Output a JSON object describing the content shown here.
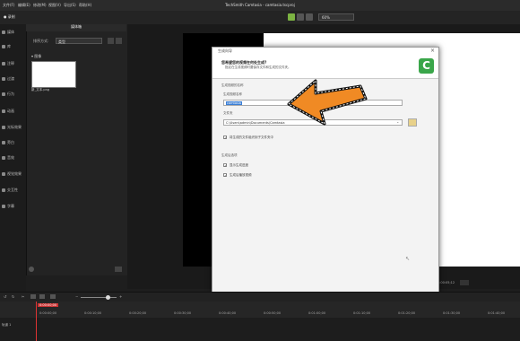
{
  "app": {
    "title": "TechSmith Camtasia - camtasia.tscproj",
    "menus": [
      "文件(F)",
      "编辑(E)",
      "修改(M)",
      "视图(V)",
      "导出(S)",
      "帮助(H)"
    ],
    "zoom": "60%"
  },
  "sidebar": {
    "items": [
      "媒体",
      "库",
      "注释",
      "过渡",
      "行为",
      "动画",
      "光标效果",
      "旁白",
      "音效",
      "视觉效果",
      "交互性",
      "字幕"
    ]
  },
  "media_bin": {
    "title": "媒体箱",
    "sort_label": "排序方式:",
    "sort_value": "类型",
    "section": "图像",
    "file_name": "新_文本.png"
  },
  "dialog": {
    "title": "生成向导",
    "heading": "您希望您的视频在何处生成?",
    "subheading": "指定在生成视频时要保存文件和生成的文件夹。",
    "section_file": "生成视频的名称",
    "label_name": "生成视频名称",
    "value_name": "camtasia",
    "label_folder": "文件夹",
    "value_folder": "C:\\Users\\admin\\Documents\\Camtasia",
    "opt_subfolder": "将生成的文件组织到子文件夹中",
    "section_options": "生成后选项",
    "opt_progress": "显示生成进度",
    "opt_play": "生成后播放视频",
    "btn_back": "< 上一步(B)",
    "btn_finish": "完成",
    "btn_cancel": "取消",
    "logo_glyph": "C"
  },
  "timeline": {
    "current_time": "0:00:00;00",
    "preview_time": "0:00:05;12",
    "ticks": [
      "0:00:00;00",
      "0:00:10;00",
      "0:00:20;00",
      "0:00:30;00",
      "0:00:40;00",
      "0:00:50;00",
      "0:01:00;00",
      "0:01:10;00",
      "0:01:20;00",
      "0:01:30;00",
      "0:01:40;00"
    ],
    "track_label": "轨道 1"
  },
  "colors": {
    "accent_orange": "#f08a24",
    "logo_green": "#3aa64a",
    "select_blue": "#3b7fd6"
  }
}
